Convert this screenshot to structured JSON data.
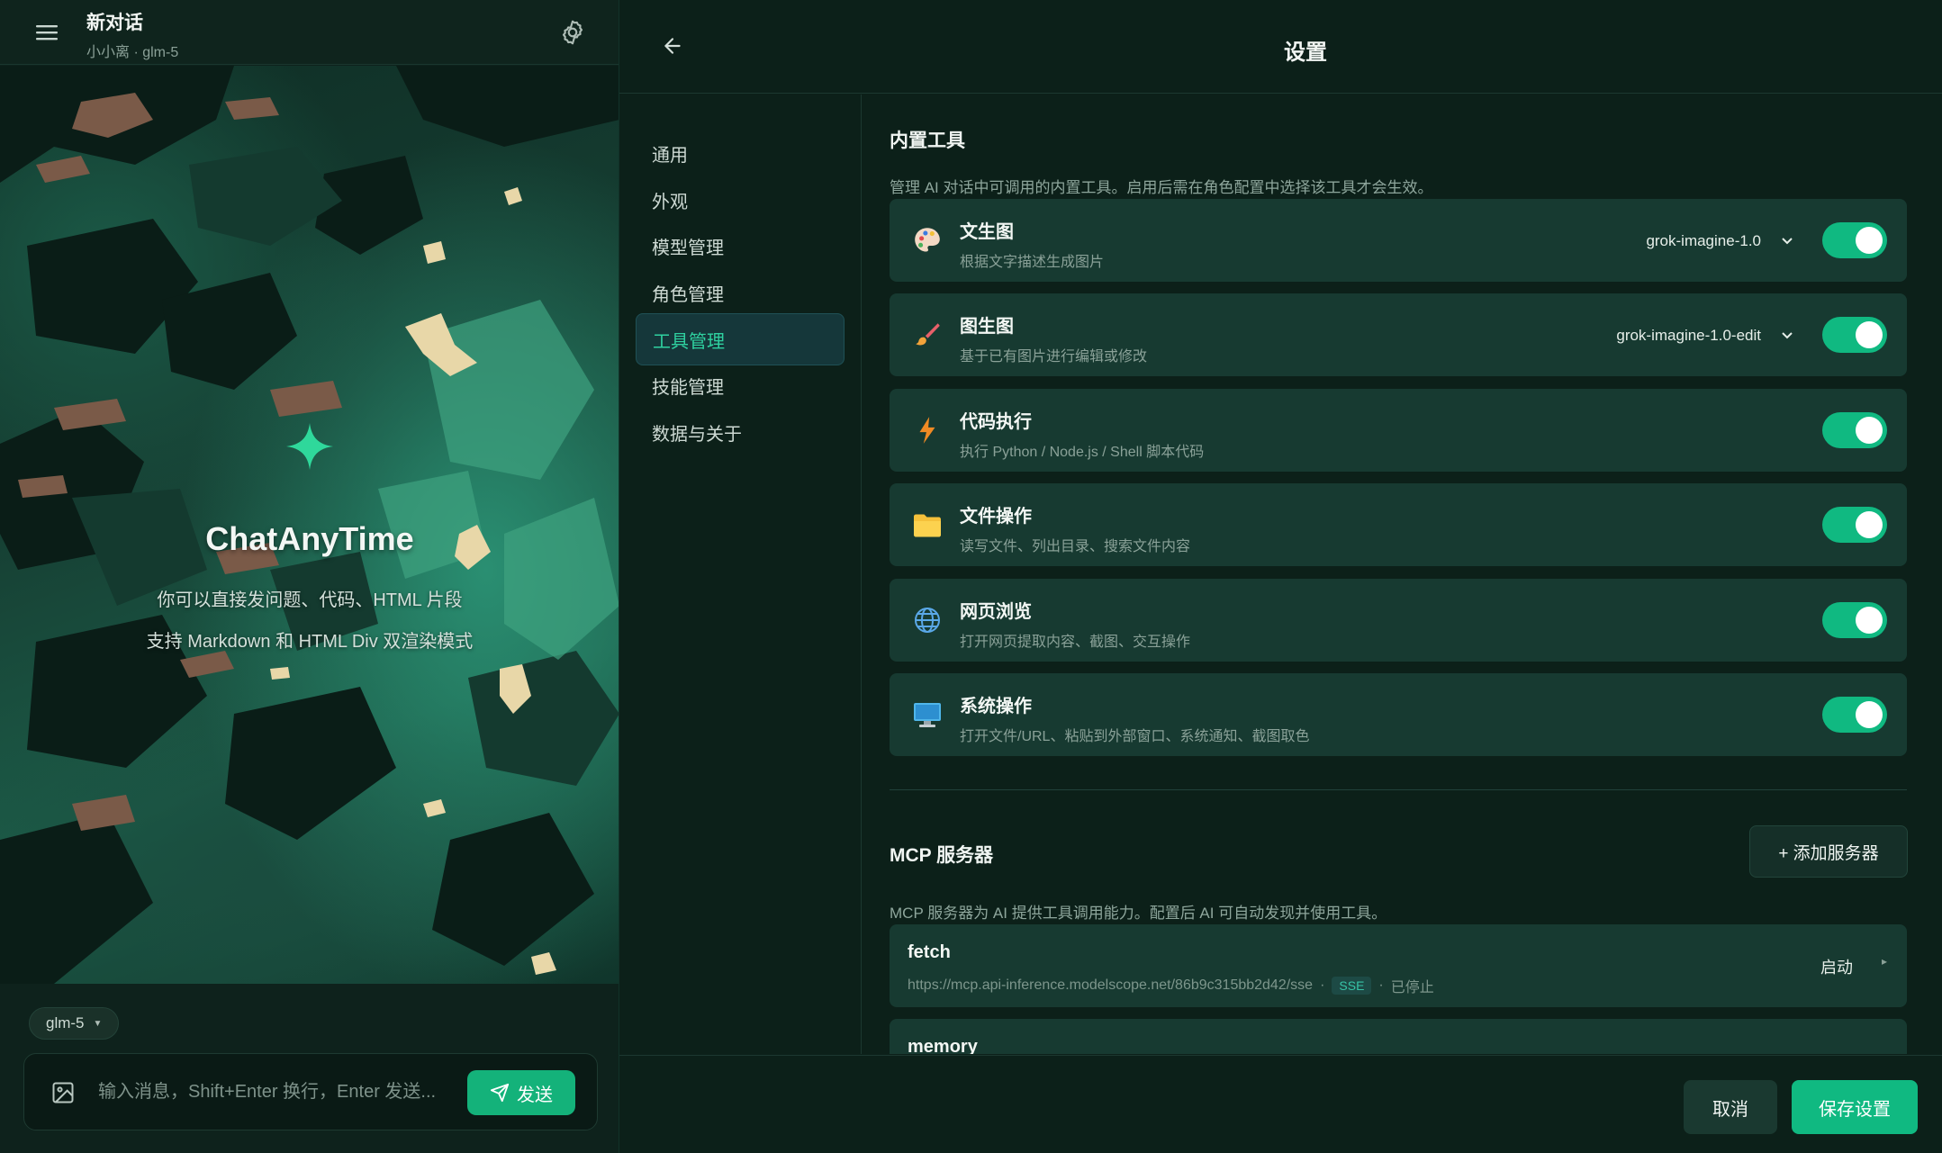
{
  "chat": {
    "title": "新对话",
    "subtitle": "小小离 · glm-5",
    "hero_title": "ChatAnyTime",
    "hero_line1": "你可以直接发问题、代码、HTML 片段",
    "hero_line2": "支持 Markdown 和 HTML Div 双渲染模式",
    "model_chip": "glm-5",
    "input_placeholder": "输入消息，Shift+Enter 换行，Enter 发送...",
    "send_label": "发送"
  },
  "settings": {
    "title": "设置",
    "nav": [
      {
        "label": "通用",
        "active": false
      },
      {
        "label": "外观",
        "active": false
      },
      {
        "label": "模型管理",
        "active": false
      },
      {
        "label": "角色管理",
        "active": false
      },
      {
        "label": "工具管理",
        "active": true
      },
      {
        "label": "技能管理",
        "active": false
      },
      {
        "label": "数据与关于",
        "active": false
      }
    ],
    "builtin": {
      "title": "内置工具",
      "desc": "管理 AI 对话中可调用的内置工具。启用后需在角色配置中选择该工具才会生效。",
      "tools": [
        {
          "name": "文生图",
          "desc": "根据文字描述生成图片",
          "model": "grok-imagine-1.0",
          "icon": "palette-icon",
          "enabled": true
        },
        {
          "name": "图生图",
          "desc": "基于已有图片进行编辑或修改",
          "model": "grok-imagine-1.0-edit",
          "icon": "paintbrush-icon",
          "enabled": true
        },
        {
          "name": "代码执行",
          "desc": "执行 Python / Node.js / Shell 脚本代码",
          "model": "",
          "icon": "lightning-icon",
          "enabled": true
        },
        {
          "name": "文件操作",
          "desc": "读写文件、列出目录、搜索文件内容",
          "model": "",
          "icon": "folder-icon",
          "enabled": true
        },
        {
          "name": "网页浏览",
          "desc": "打开网页提取内容、截图、交互操作",
          "model": "",
          "icon": "globe-icon",
          "enabled": true
        },
        {
          "name": "系统操作",
          "desc": "打开文件/URL、粘贴到外部窗口、系统通知、截图取色",
          "model": "",
          "icon": "monitor-icon",
          "enabled": true
        }
      ]
    },
    "mcp": {
      "title": "MCP 服务器",
      "add_label": "+ 添加服务器",
      "desc": "MCP 服务器为 AI 提供工具调用能力。配置后 AI 可自动发现并使用工具。",
      "servers": [
        {
          "name": "fetch",
          "url": "https://mcp.api-inference.modelscope.net/86b9c315bb2d42/sse",
          "dot": "·",
          "transport": "SSE",
          "status": "已停止",
          "action": "启动"
        },
        {
          "name": "memory",
          "url": "",
          "dot": "",
          "transport": "",
          "status": "",
          "action": ""
        }
      ]
    },
    "cancel_label": "取消",
    "save_label": "保存设置"
  },
  "colors": {
    "accent": "#10b981",
    "active_nav_text": "#2fd1a0",
    "card_bg": "#173a31",
    "panel_bg": "#0c2019"
  }
}
